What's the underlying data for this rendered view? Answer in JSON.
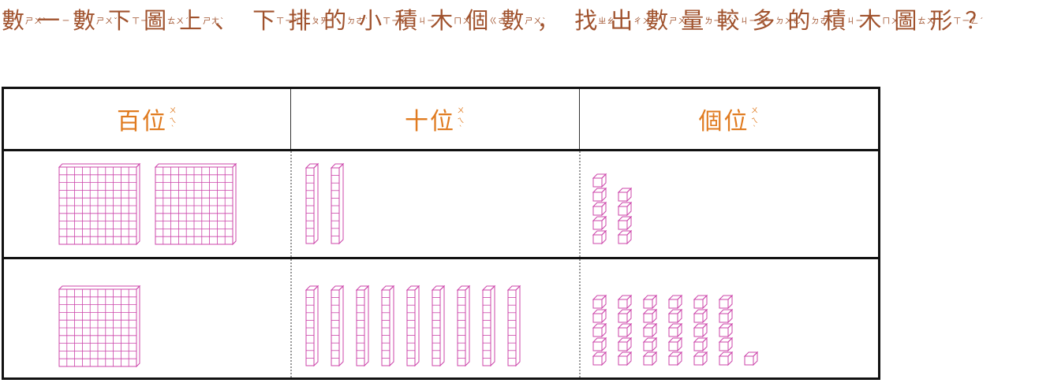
{
  "question": {
    "segments": [
      {
        "char": "數",
        "zhuyin": "ㄕㄨˋ"
      },
      {
        "char": "一",
        "zhuyin": "ㄧ"
      },
      {
        "char": "數",
        "zhuyin": "ㄕㄨˇ"
      },
      {
        "char": "下",
        "zhuyin": "ㄒㄧㄚˋ"
      },
      {
        "char": "圖",
        "zhuyin": "ㄊㄨˊ"
      },
      {
        "char": "上",
        "zhuyin": "ㄕㄤˋ"
      },
      {
        "char": "、",
        "zhuyin": ""
      },
      {
        "char": "下",
        "zhuyin": "ㄒㄧㄚˋ"
      },
      {
        "char": "排",
        "zhuyin": "ㄆㄞˊ"
      },
      {
        "char": "的",
        "zhuyin": "ㄉㄜ˙"
      },
      {
        "char": "小",
        "zhuyin": "ㄒㄧㄠˇ"
      },
      {
        "char": "積",
        "zhuyin": "ㄐㄧ"
      },
      {
        "char": "木",
        "zhuyin": "ㄇㄨˋ"
      },
      {
        "char": "個",
        "zhuyin": "ㄍㄜˋ"
      },
      {
        "char": "數",
        "zhuyin": "ㄕㄨˋ"
      },
      {
        "char": "，",
        "zhuyin": ""
      },
      {
        "char": "找",
        "zhuyin": "ㄓㄠˇ"
      },
      {
        "char": "出",
        "zhuyin": "ㄔㄨ"
      },
      {
        "char": "數",
        "zhuyin": "ㄕㄨˋ"
      },
      {
        "char": "量",
        "zhuyin": "ㄌㄧㄤˋ"
      },
      {
        "char": "較",
        "zhuyin": "ㄐㄧㄠˋ"
      },
      {
        "char": "多",
        "zhuyin": "ㄉㄨㄛ"
      },
      {
        "char": "的",
        "zhuyin": "ㄉㄜ˙"
      },
      {
        "char": "積",
        "zhuyin": "ㄐㄧ"
      },
      {
        "char": "木",
        "zhuyin": "ㄇㄨˋ"
      },
      {
        "char": "圖",
        "zhuyin": "ㄊㄨˊ"
      },
      {
        "char": "形",
        "zhuyin": "ㄒㄧㄥˊ"
      },
      {
        "char": "？",
        "zhuyin": ""
      }
    ]
  },
  "table": {
    "headers": [
      {
        "label": "百位",
        "zhuyin": "ㄨㄟˋ"
      },
      {
        "label": "十位",
        "zhuyin": "ㄨㄟˋ"
      },
      {
        "label": "個位",
        "zhuyin": "ㄨㄟˋ"
      }
    ],
    "rows": [
      {
        "hundreds": 2,
        "tens": 2,
        "ones": 9
      },
      {
        "hundreds": 1,
        "tens": 9,
        "ones": 31
      }
    ]
  },
  "colors": {
    "question_text": "#a0522d",
    "header_text": "#e07b20",
    "block_stroke": "#cc44aa",
    "table_border": "#111111"
  }
}
